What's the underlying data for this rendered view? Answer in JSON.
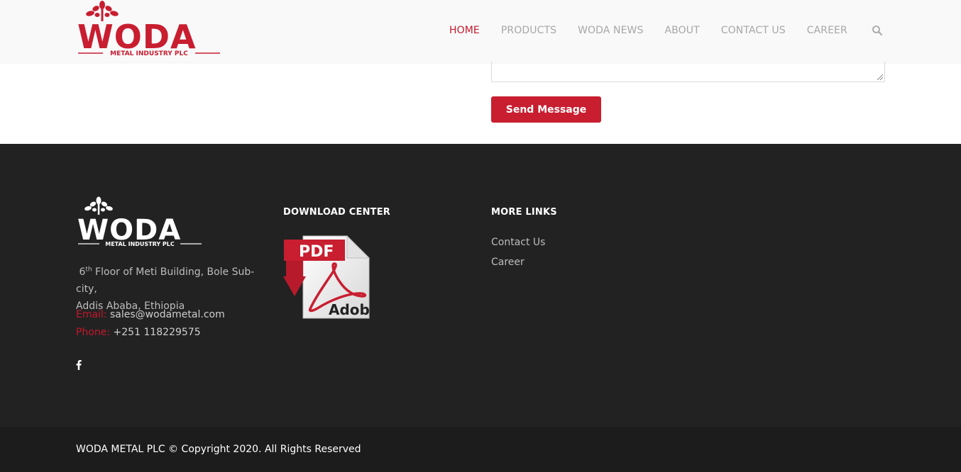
{
  "header": {
    "logo": {
      "brand": "WODA",
      "tagline": "METAL INDUSTRY PLC"
    },
    "nav": [
      {
        "label": "HOME",
        "active": true
      },
      {
        "label": "PRODUCTS",
        "active": false
      },
      {
        "label": "WODA NEWS",
        "active": false
      },
      {
        "label": "ABOUT",
        "active": false
      },
      {
        "label": "CONTACT US",
        "active": false
      },
      {
        "label": "CAREER",
        "active": false
      }
    ],
    "search_icon": "search-icon"
  },
  "form": {
    "send_label": "Send Message"
  },
  "footer": {
    "logo": {
      "brand": "WODA",
      "tagline": "METAL INDUSTRY PLC"
    },
    "address": {
      "floor_num": "6",
      "floor_sup": "th",
      "line1_rest": " Floor of Meti Building, Bole Sub-city,",
      "line2": "Addis Ababa, Ethiopia"
    },
    "email": {
      "label": "Email:",
      "value": "sales@wodametal.com"
    },
    "phone": {
      "label": "Phone:",
      "value": "+251 118229575"
    },
    "social_icon": "facebook-icon",
    "download": {
      "title": "DOWNLOAD CENTER",
      "pdf_badge": "PDF",
      "pdf_brand": "Adobe"
    },
    "more_links": {
      "title": "MORE LINKS",
      "items": [
        "Contact Us",
        "Career"
      ]
    },
    "copyright": "WODA METAL PLC © Copyright 2020. All Rights Reserved"
  },
  "colors": {
    "brand_red": "#c3182b",
    "footer_bg": "#222222",
    "bottom_bg": "#1c1c1c"
  }
}
